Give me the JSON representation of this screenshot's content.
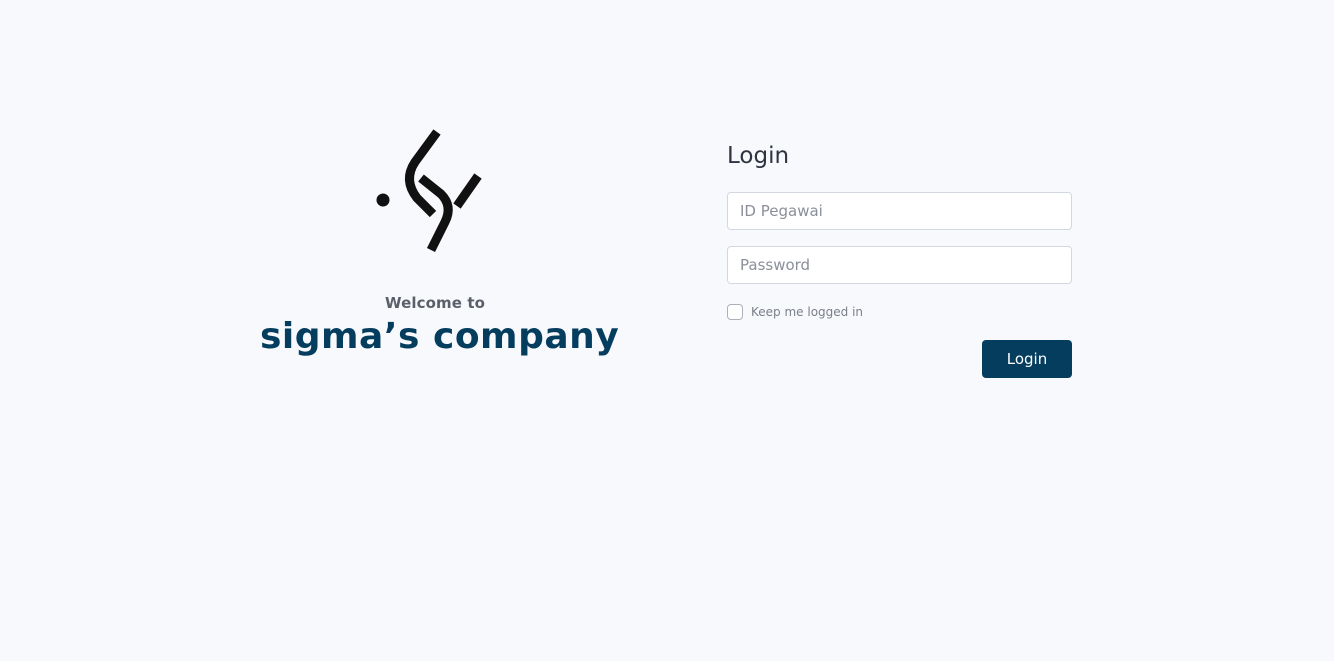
{
  "brand": {
    "logo_icon": "sigma-logo-icon",
    "welcome_text": "Welcome to",
    "company_name": "sigma’s company"
  },
  "login": {
    "title": "Login",
    "id_field": {
      "placeholder": "ID Pegawai",
      "value": ""
    },
    "password_field": {
      "placeholder": "Password",
      "value": ""
    },
    "remember_label": "Keep me logged in",
    "remember_checked": false,
    "submit_label": "Login"
  },
  "colors": {
    "background": "#f7f9fc",
    "brand_primary": "#043d5d",
    "text_muted": "#5b5f6a"
  }
}
